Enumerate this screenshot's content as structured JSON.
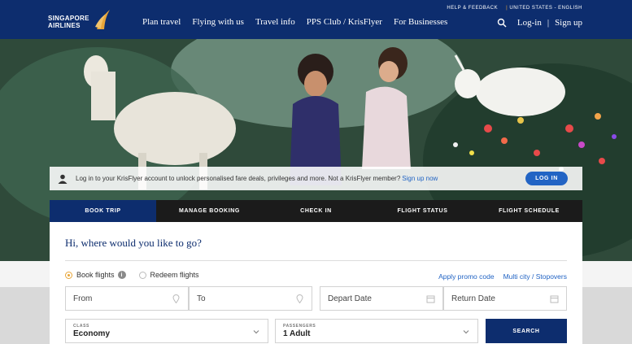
{
  "brand": {
    "line1": "SINGAPORE",
    "line2": "AIRLINES",
    "accent": "#e8a538",
    "navy": "#0d2d6e"
  },
  "nav": [
    "Plan travel",
    "Flying with us",
    "Travel info",
    "PPS Club / KrisFlyer",
    "For Businesses"
  ],
  "utility": {
    "help": "HELP & FEEDBACK",
    "locale": "UNITED STATES - ENGLISH"
  },
  "account": {
    "login": "Log-in",
    "signup": "Sign up"
  },
  "login_bar": {
    "message": "Log in to your KrisFlyer account to unlock personalised fare deals, privileges and more. Not a KrisFlyer member?",
    "signup_link": "Sign up now",
    "button": "LOG IN"
  },
  "tabs": [
    "BOOK TRIP",
    "MANAGE BOOKING",
    "CHECK IN",
    "FLIGHT STATUS",
    "FLIGHT SCHEDULE"
  ],
  "booking": {
    "title": "Hi, where would you like to go?",
    "option_book": "Book flights",
    "option_redeem": "Redeem flights",
    "promo": "Apply promo code",
    "multicity": "Multi city / Stopovers",
    "from": "From",
    "to": "To",
    "depart": "Depart Date",
    "return": "Return Date",
    "class_caption": "CLASS",
    "class_value": "Economy",
    "passengers_caption": "PASSENGERS",
    "passengers_value": "1 Adult",
    "search": "SEARCH"
  }
}
